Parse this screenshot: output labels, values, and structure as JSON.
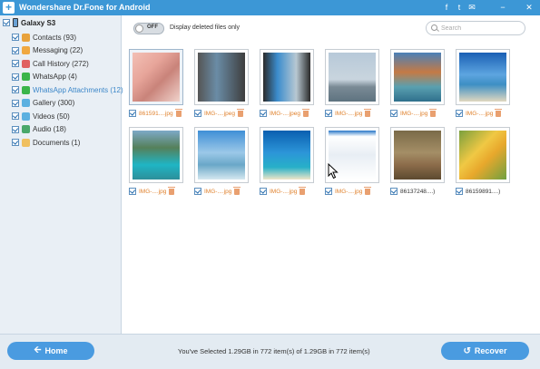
{
  "app": {
    "title": "Wondershare Dr.Fone for Android"
  },
  "window_controls": [
    "f",
    "t",
    "✉",
    "−",
    "✕"
  ],
  "device": {
    "name": "Galaxy S3"
  },
  "sidebar": {
    "items": [
      {
        "label": "Contacts (93)",
        "color": "#e8a23c",
        "active": false
      },
      {
        "label": "Messaging (22)",
        "color": "#f0a840",
        "active": false
      },
      {
        "label": "Call History (272)",
        "color": "#e06060",
        "active": false
      },
      {
        "label": "WhatsApp (4)",
        "color": "#3ab54a",
        "active": false
      },
      {
        "label": "WhatsApp Attachments (12)",
        "color": "#3ab54a",
        "active": true
      },
      {
        "label": "Gallery (300)",
        "color": "#5bb0e0",
        "active": false
      },
      {
        "label": "Videos (50)",
        "color": "#5bb0e0",
        "active": false
      },
      {
        "label": "Audio (18)",
        "color": "#4aa86a",
        "active": false
      },
      {
        "label": "Documents (1)",
        "color": "#f0c060",
        "active": false
      }
    ]
  },
  "toolbar": {
    "toggle_label": "OFF",
    "deleted_label": "Display deleted files only",
    "search_placeholder": "Search"
  },
  "photos": [
    {
      "name": "861591....jpg",
      "orange": true,
      "bg": "linear-gradient(135deg,#f3c0b5 0%,#e7a59a 35%,#c9837a 60%,#f0d3cc 100%)"
    },
    {
      "name": "IMG-....jpeg",
      "orange": true,
      "bg": "linear-gradient(90deg,#555 0%,#6a8ca6 40%,#3e3e3e 100%)"
    },
    {
      "name": "IMG-....jpeg",
      "orange": true,
      "bg": "linear-gradient(90deg,#2a2a2a 0%,#3b8ccd 30%,#b8c8d2 70%,#2a2a2a 100%)"
    },
    {
      "name": "IMG-....jpg",
      "orange": true,
      "bg": "linear-gradient(180deg,#b7c9d9 0%,#c9d5de 55%,#7a8a95 70%,#5e7380 100%)"
    },
    {
      "name": "IMG-....jpg",
      "orange": true,
      "bg": "linear-gradient(180deg,#4a80b8 0%,#c47a45 40%,#5aa0b0 70%,#2f6f8c 100%)"
    },
    {
      "name": "IMG-....jpg",
      "orange": true,
      "bg": "linear-gradient(180deg,#1a5fb4 0%,#5da5e0 45%,#3d8fc4 65%,#e0d8c0 100%)"
    },
    {
      "name": "IMG-....jpg",
      "orange": true,
      "bg": "linear-gradient(180deg,#7da9c8 0%,#55805a 35%,#1fb5c4 70%,#2d8f9a 100%)"
    },
    {
      "name": "IMG-....jpg",
      "orange": true,
      "bg": "linear-gradient(180deg,#3f8fd6 0%,#9bc8e8 45%,#6aa7c8 70%,#d5e8f0 100%)"
    },
    {
      "name": "IMG-....jpg",
      "orange": true,
      "bg": "linear-gradient(180deg,#0a5fb0 0%,#2c95d8 45%,#27b0c8 75%,#f0e6c8 100%)"
    },
    {
      "name": "IMG-....jpg",
      "orange": true,
      "bg": "linear-gradient(180deg,#2a78c8 0%,#ffffff 12%,#e8eef4 50%,#ffffff 100%)"
    },
    {
      "name": "86137248....)",
      "orange": false,
      "bg": "linear-gradient(180deg,#7a6a48 0%,#a48e66 45%,#8c6c4a 70%,#5c4a30 100%)"
    },
    {
      "name": "86159891....)",
      "orange": false,
      "bg": "linear-gradient(135deg,#7aa03e 0%,#f0c844 40%,#e8a82c 60%,#6fa040 100%)"
    }
  ],
  "footer": {
    "home_label": "Home",
    "recover_label": "Recover",
    "status": "You've Selected 1.29GB in 772 item(s) of 1.29GB in 772 item(s)"
  }
}
